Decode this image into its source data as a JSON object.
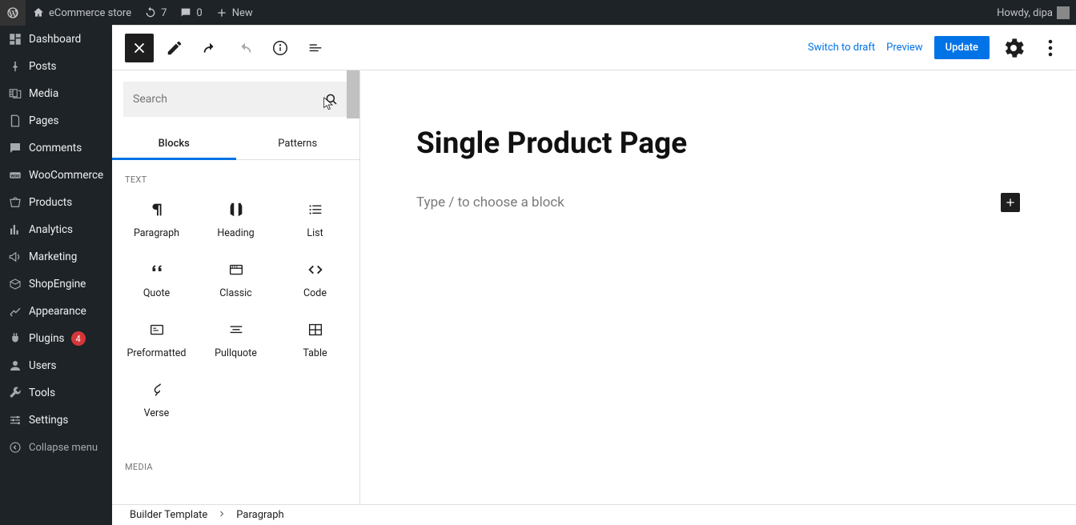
{
  "adminBar": {
    "siteName": "eCommerce store",
    "refreshCount": "7",
    "commentsCount": "0",
    "newLabel": "New",
    "greeting": "Howdy, dipa"
  },
  "sidebar": {
    "items": [
      {
        "label": "Dashboard",
        "icon": "dashboard"
      },
      {
        "label": "Posts",
        "icon": "pin"
      },
      {
        "label": "Media",
        "icon": "media"
      },
      {
        "label": "Pages",
        "icon": "pages"
      },
      {
        "label": "Comments",
        "icon": "comments"
      },
      {
        "label": "WooCommerce",
        "icon": "woo"
      },
      {
        "label": "Products",
        "icon": "products"
      },
      {
        "label": "Analytics",
        "icon": "analytics"
      },
      {
        "label": "Marketing",
        "icon": "marketing"
      },
      {
        "label": "ShopEngine",
        "icon": "shopengine"
      },
      {
        "label": "Appearance",
        "icon": "appearance"
      },
      {
        "label": "Plugins",
        "icon": "plugins",
        "badge": "4"
      },
      {
        "label": "Users",
        "icon": "users"
      },
      {
        "label": "Tools",
        "icon": "tools"
      },
      {
        "label": "Settings",
        "icon": "settings"
      },
      {
        "label": "Collapse menu",
        "icon": "collapse"
      }
    ]
  },
  "toolbar": {
    "switchDraft": "Switch to draft",
    "preview": "Preview",
    "update": "Update"
  },
  "inserter": {
    "searchPlaceholder": "Search",
    "tabs": {
      "blocks": "Blocks",
      "patterns": "Patterns"
    },
    "sections": [
      {
        "label": "TEXT",
        "key": "text",
        "blocks": [
          {
            "label": "Paragraph",
            "icon": "paragraph"
          },
          {
            "label": "Heading",
            "icon": "heading"
          },
          {
            "label": "List",
            "icon": "list"
          },
          {
            "label": "Quote",
            "icon": "quote"
          },
          {
            "label": "Classic",
            "icon": "classic"
          },
          {
            "label": "Code",
            "icon": "code"
          },
          {
            "label": "Preformatted",
            "icon": "preformatted"
          },
          {
            "label": "Pullquote",
            "icon": "pullquote"
          },
          {
            "label": "Table",
            "icon": "table"
          },
          {
            "label": "Verse",
            "icon": "verse"
          }
        ]
      },
      {
        "label": "MEDIA",
        "key": "media",
        "blocks": []
      }
    ]
  },
  "canvas": {
    "title": "Single Product Page",
    "placeholder": "Type / to choose a block"
  },
  "breadcrumb": {
    "root": "Builder Template",
    "leaf": "Paragraph"
  }
}
